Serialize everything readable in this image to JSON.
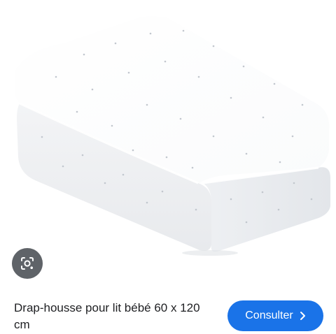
{
  "product": {
    "title": "Drap-housse pour lit bébé 60 x 120 cm",
    "image_icon": "fitted-sheet-image"
  },
  "actions": {
    "lens_icon": "camera-lens-icon",
    "consult_label": "Consulter",
    "consult_icon": "chevron-right-icon"
  },
  "colors": {
    "button_blue": "#1a73e8",
    "lens_bg": "#5f6368",
    "text": "#202124"
  }
}
